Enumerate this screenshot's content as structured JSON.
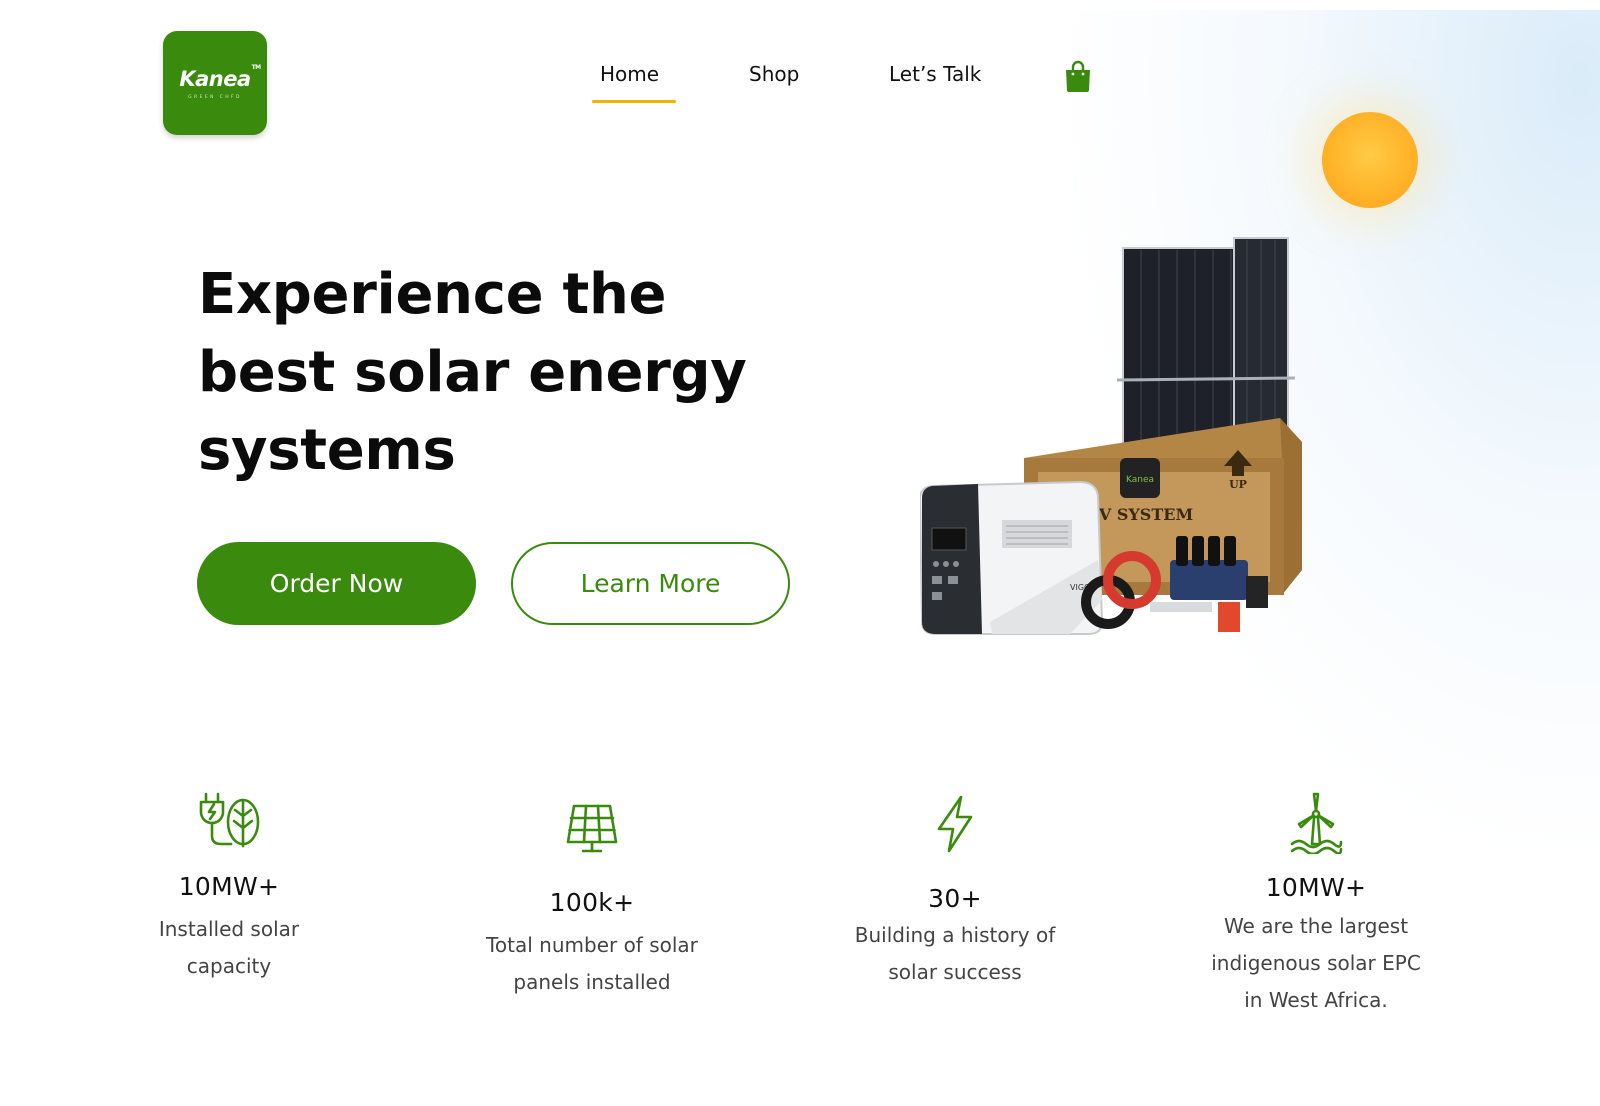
{
  "brand": {
    "logo_text": "Kanea",
    "logo_tm": "TM",
    "logo_subtext": "GREEN CHFD",
    "accent": "#3a8a0e",
    "underline": "#f2b300"
  },
  "nav": {
    "items": [
      {
        "label": "Home",
        "active": true
      },
      {
        "label": "Shop",
        "active": false
      },
      {
        "label": "Let’s Talk",
        "active": false
      }
    ],
    "cart_icon": "shopping-bag-icon"
  },
  "hero": {
    "title": "Experience the best solar energy systems",
    "title_lines": [
      "Experience the",
      "best solar energy",
      "systems"
    ],
    "primary_button": "Order Now",
    "secondary_button": "Learn More",
    "product_labels": {
      "crate_text": "PV SYSTEM",
      "crate_arrow_text": "UP",
      "crate_brand": "Kanea",
      "station_brand": "VIGO"
    }
  },
  "stats": [
    {
      "icon": "plug-leaf-icon",
      "value": "10MW+",
      "label_lines": [
        "Installed solar",
        "capacity"
      ]
    },
    {
      "icon": "solar-panel-icon",
      "value": "100k+",
      "label_lines": [
        "Total number of solar",
        "panels installed"
      ]
    },
    {
      "icon": "lightning-bolt-icon",
      "value": "30+",
      "label_lines": [
        "Building a history of",
        "solar success"
      ]
    },
    {
      "icon": "wind-turbine-icon",
      "value": "10MW+",
      "label_lines": [
        "We are the largest",
        "indigenous solar EPC",
        "in West Africa."
      ]
    }
  ]
}
